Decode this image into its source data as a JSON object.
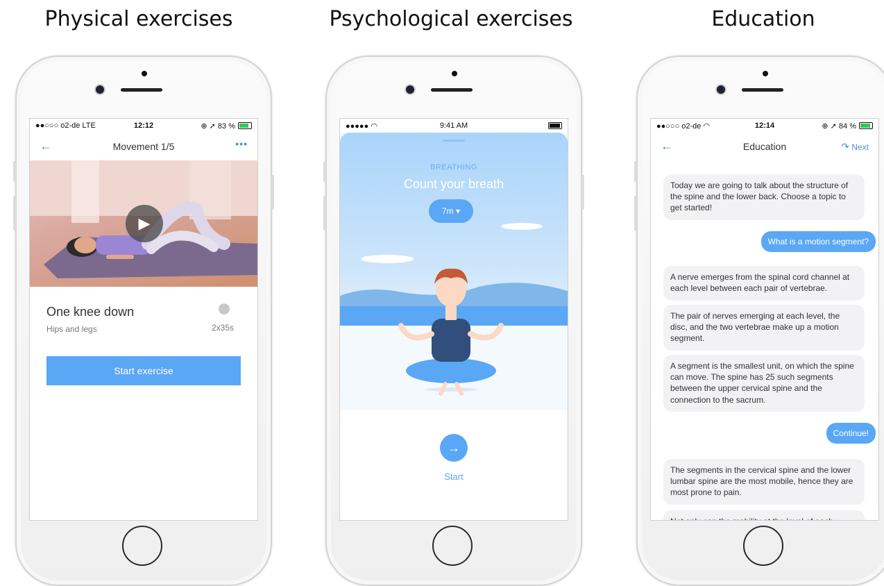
{
  "columns": [
    {
      "title": "Physical exercises"
    },
    {
      "title": "Psychological exercises"
    },
    {
      "title": "Education"
    }
  ],
  "phone1": {
    "status": {
      "carrier": "●●○○○ o2-de  LTE",
      "time": "12:12",
      "right": "⊕ ➚ 83 %"
    },
    "nav": {
      "title": "Movement 1/5",
      "back": "←",
      "more": "•••"
    },
    "exercise": {
      "name": "One knee down",
      "subtitle": "Hips and legs",
      "duration": "2x35s"
    },
    "start_label": "Start exercise"
  },
  "phone2": {
    "status": {
      "signal": "●●●●● ◠",
      "time": "9:41 AM"
    },
    "category": "BREATHING",
    "title": "Count your breath",
    "duration": "7m ▾",
    "start_label": "Start"
  },
  "phone3": {
    "status": {
      "carrier": "●●○○○ o2-de ◠",
      "time": "12:14",
      "right": "⊕ ➚ 84 %"
    },
    "nav": {
      "title": "Education",
      "back": "←",
      "next": "Next"
    },
    "messages": [
      {
        "side": "left",
        "text": "Today we are going to talk about the structure of the spine and the lower back. Choose a topic to get started!"
      },
      {
        "side": "right",
        "text": "What is a motion segment?"
      },
      {
        "side": "left",
        "text": "A nerve emerges from the spinal cord channel at each level between each pair of vertebrae."
      },
      {
        "side": "left",
        "text": "The pair of nerves emerging at each level, the disc, and the two vertebrae make up a motion segment."
      },
      {
        "side": "left",
        "text": "A segment is the smallest unit, on which the spine can move. The spine has 25 such segments between the upper cervical spine and the connection to the sacrum."
      },
      {
        "side": "right",
        "text": "Continue!"
      },
      {
        "side": "left",
        "text": "The segments in the cervical spine and the lower lumbar spine are the most mobile, hence they are most prone to pain."
      },
      {
        "side": "left",
        "text": "Not only can the mobility at the level of each"
      }
    ]
  },
  "colors": {
    "accent": "#5aa7f5",
    "bubble": "#f2f2f4",
    "sky": "#bfe0fb"
  }
}
